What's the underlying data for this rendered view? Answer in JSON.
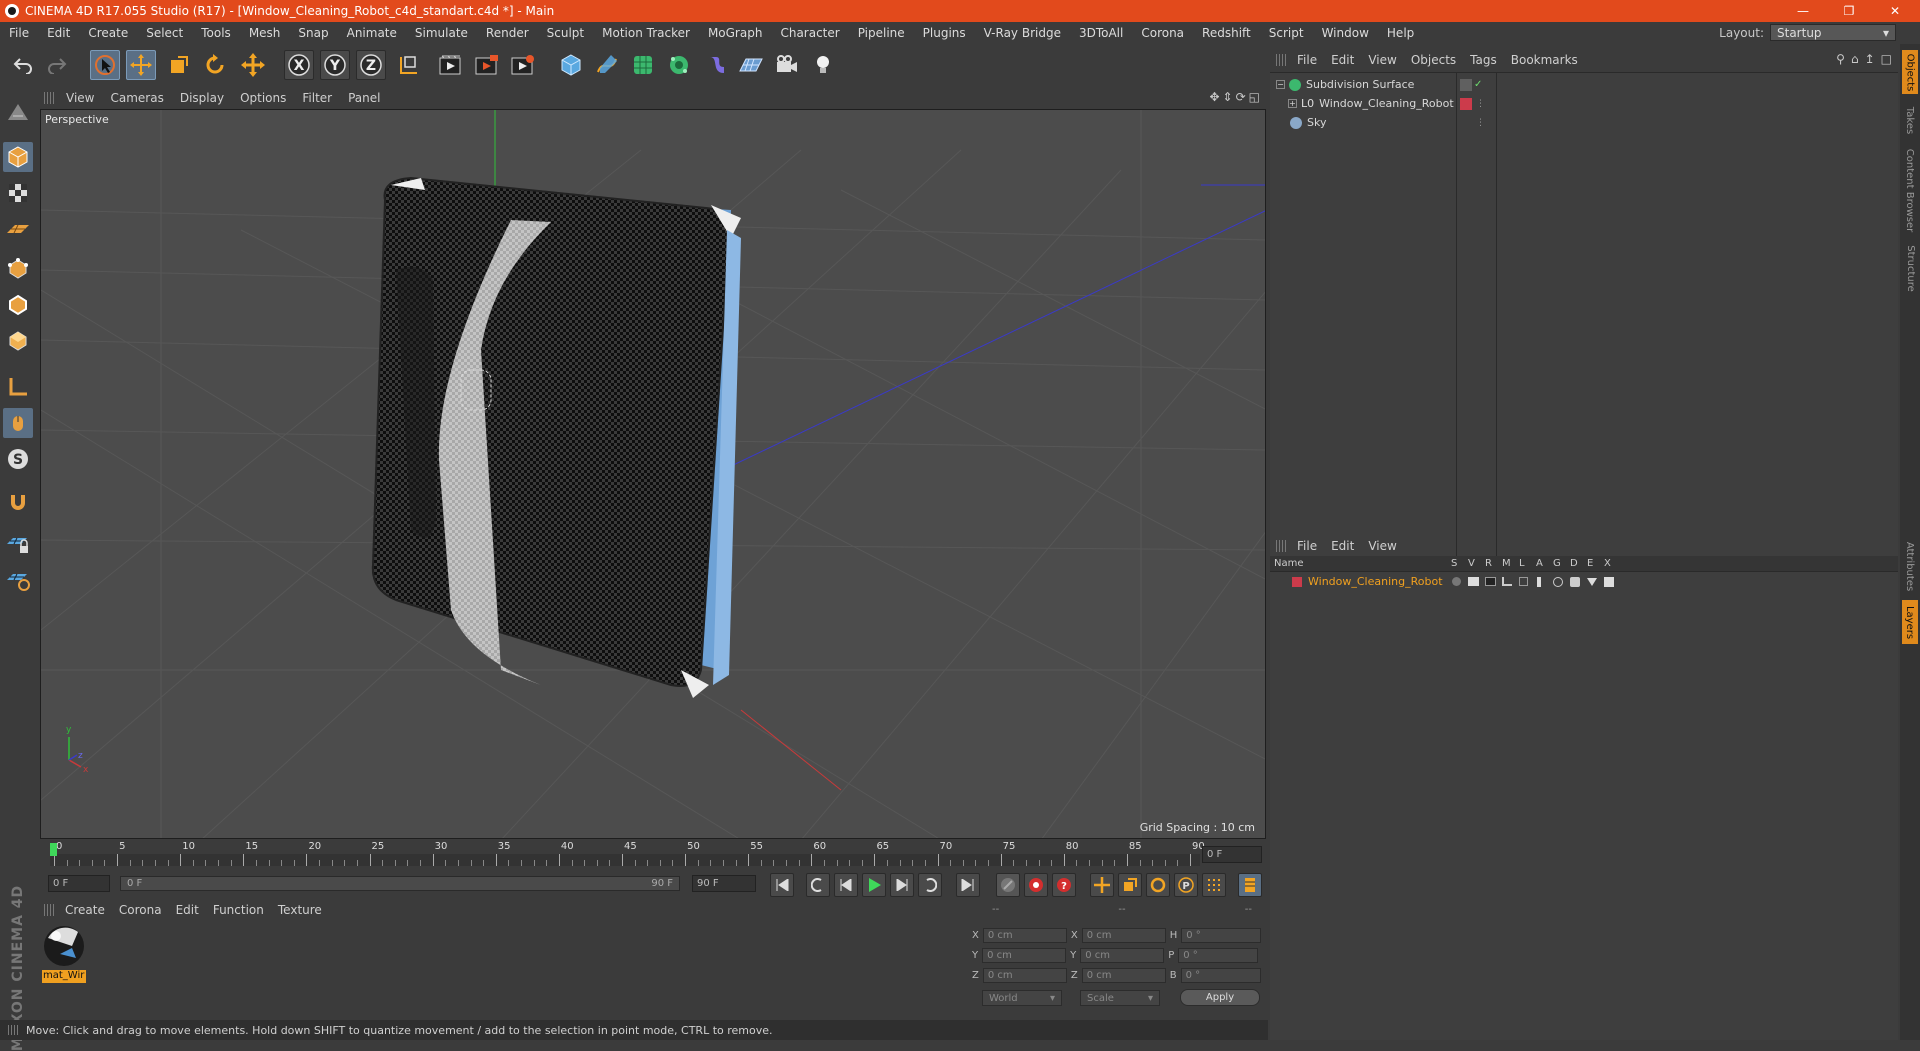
{
  "window": {
    "title": "CINEMA 4D R17.055 Studio (R17) - [Window_Cleaning_Robot_c4d_standart.c4d *] - Main",
    "minimize_icon": "minimize-icon",
    "restore_icon": "restore-icon",
    "close_icon": "close-icon"
  },
  "menubar": {
    "items": [
      "File",
      "Edit",
      "Create",
      "Select",
      "Tools",
      "Mesh",
      "Snap",
      "Animate",
      "Simulate",
      "Render",
      "Sculpt",
      "Motion Tracker",
      "MoGraph",
      "Character",
      "Pipeline",
      "Plugins",
      "V-Ray Bridge",
      "3DToAll",
      "Corona",
      "Redshift",
      "Script",
      "Window",
      "Help"
    ],
    "layout_label": "Layout:",
    "layout_value": "Startup"
  },
  "toolbar": {
    "icons": [
      "undo-icon",
      "redo-icon",
      "live-selection-icon",
      "move-icon",
      "scale-icon",
      "rotate-icon",
      "last-tool-icon",
      "x-axis-icon",
      "y-axis-icon",
      "z-axis-icon",
      "world-coordinates-icon",
      "render-view-icon",
      "render-picture-viewer-icon",
      "edit-render-settings-icon",
      "cube-icon",
      "pen-spline-icon",
      "subdivision-surface-icon",
      "cloner-icon",
      "deformer-icon",
      "floor-icon",
      "camera-icon",
      "light-icon"
    ],
    "x_label": "X",
    "y_label": "Y",
    "z_label": "Z"
  },
  "left_tools": [
    "make-editable-icon",
    "model-mode-icon",
    "texture-mode-icon",
    "workplane-icon",
    "points-mode-icon",
    "edges-mode-icon",
    "polygons-mode-icon",
    "axis-mode-icon",
    "tweak-mode-icon",
    "solo-mode-icon",
    "snap-magnet-icon",
    "lock-workplane-icon",
    "planar-workplane-icon"
  ],
  "viewport": {
    "menu": [
      "View",
      "Cameras",
      "Display",
      "Options",
      "Filter",
      "Panel"
    ],
    "label": "Perspective",
    "grid_spacing": "Grid Spacing : 10 cm",
    "nav_icons": [
      "move-view-icon",
      "zoom-view-icon",
      "rotate-view-icon",
      "maximize-view-icon"
    ]
  },
  "timeline": {
    "ticks": [
      "0",
      "5",
      "10",
      "15",
      "20",
      "25",
      "30",
      "35",
      "40",
      "45",
      "50",
      "55",
      "60",
      "65",
      "70",
      "75",
      "80",
      "85",
      "90"
    ],
    "current_frame": "0 F",
    "start_frame": "0 F",
    "range_start": "0 F",
    "range_end": "90 F",
    "end_frame": "90 F"
  },
  "transport_icons": [
    "goto-start-icon",
    "prev-keyframe-icon",
    "prev-frame-icon",
    "play-icon",
    "next-frame-icon",
    "next-keyframe-icon",
    "goto-end-icon",
    "record-active-icon",
    "autokey-icon",
    "keyframe-selection-icon",
    "position-key-icon",
    "scale-key-icon",
    "rotation-key-icon",
    "parameter-key-icon",
    "pla-key-icon",
    "timeline-icon"
  ],
  "material_panel": {
    "menu": [
      "Create",
      "Corona",
      "Edit",
      "Function",
      "Texture"
    ],
    "material_name": "mat_Wir"
  },
  "coordinates": {
    "headers": [
      "--",
      "--",
      "--"
    ],
    "rows": [
      {
        "a_label": "X",
        "a_value": "0 cm",
        "b_label": "X",
        "b_value": "0 cm",
        "c_label": "H",
        "c_value": "0 °"
      },
      {
        "a_label": "Y",
        "a_value": "0 cm",
        "b_label": "Y",
        "b_value": "0 cm",
        "c_label": "P",
        "c_value": "0 °"
      },
      {
        "a_label": "Z",
        "a_value": "0 cm",
        "b_label": "Z",
        "b_value": "0 cm",
        "c_label": "B",
        "c_value": "0 °"
      }
    ],
    "mode": "World",
    "size_mode": "Scale",
    "apply": "Apply"
  },
  "status": "Move: Click and drag to move elements. Hold down SHIFT to quantize movement / add to the selection in point mode, CTRL to remove.",
  "object_manager": {
    "menu": [
      "File",
      "Edit",
      "View",
      "Objects",
      "Tags",
      "Bookmarks"
    ],
    "objects": [
      {
        "name": "Subdivision Surface",
        "icon": "subdivision-surface-icon",
        "color": "#55c880"
      },
      {
        "name": "Window_Cleaning_Robot",
        "icon": "null-object-icon",
        "color": "#d0d0d0",
        "tag_color": "#cc3b4b"
      },
      {
        "name": "Sky",
        "icon": "sky-icon",
        "color": "#8aa8c8"
      }
    ]
  },
  "layer_manager": {
    "menu": [
      "File",
      "Edit",
      "View"
    ],
    "columns": [
      "Name",
      "S",
      "V",
      "R",
      "M",
      "L",
      "A",
      "G",
      "D",
      "E",
      "X"
    ],
    "layers": [
      {
        "name": "Window_Cleaning_Robot",
        "color": "#cc3b4b"
      }
    ]
  },
  "side_tabs": [
    "Objects",
    "Takes",
    "Content Browser",
    "Structure",
    "Attributes",
    "Layers"
  ],
  "colors": {
    "accent": "#e24a1c",
    "highlight_orange": "#f0a020",
    "layer_red": "#cc3b4b"
  }
}
